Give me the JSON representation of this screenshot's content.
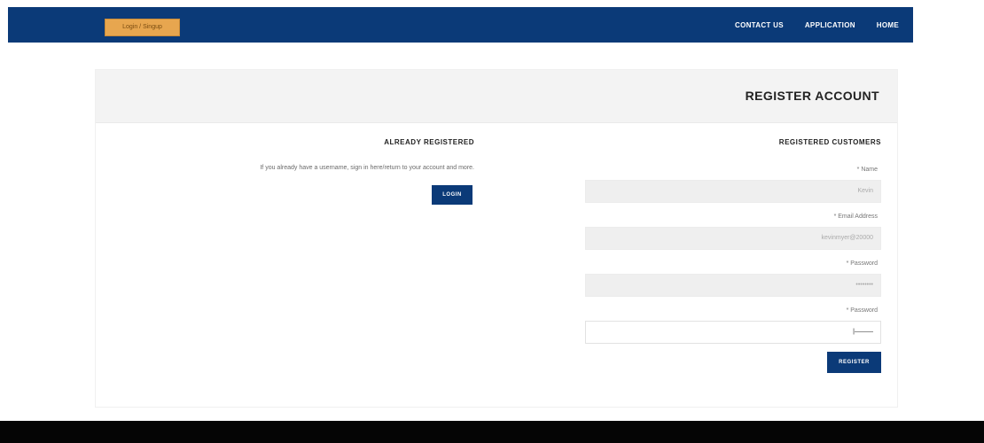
{
  "topbar": {
    "login_badge": "Login / Singup",
    "nav": [
      {
        "label": "CONTACT US"
      },
      {
        "label": "APPLICATION"
      },
      {
        "label": "HOME"
      }
    ]
  },
  "card": {
    "title": "REGISTER ACCOUNT"
  },
  "already_registered": {
    "title": "ALREADY REGISTERED",
    "text": "If you already have a username, sign in here/return to your account and more.",
    "login_button": "LOGIN"
  },
  "registered_customers": {
    "title": "REGISTERED CUSTOMERS",
    "fields": {
      "name": {
        "label": "* Name",
        "value": "Kevin"
      },
      "email": {
        "label": "* Email Address",
        "value": "kevinmyer@20000"
      },
      "password": {
        "label": "* Password",
        "value": "••••••••"
      },
      "confirm_password": {
        "label": "* Password",
        "value": "|———"
      }
    },
    "register_button": "REGISTER"
  },
  "colors": {
    "primary": "#0b3a78",
    "badge": "#e7a64f",
    "footer": "#050505"
  }
}
